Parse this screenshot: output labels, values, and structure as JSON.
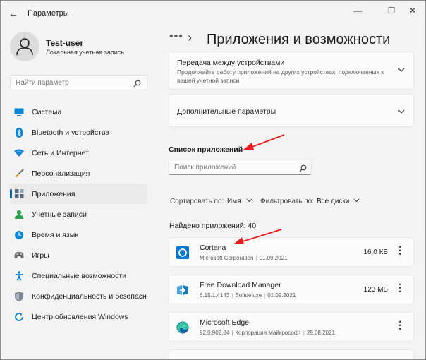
{
  "window": {
    "title": "Параметры",
    "back_glyph": "←",
    "controls": [
      "—",
      "☐",
      "✕"
    ]
  },
  "profile": {
    "name": "Test-user",
    "account_type": "Локальная учетная запись"
  },
  "sidebar_search": {
    "placeholder": "Найти параметр"
  },
  "nav": {
    "items": [
      {
        "label": "Система",
        "icon": "monitor-icon",
        "active": false
      },
      {
        "label": "Bluetooth и устройства",
        "icon": "bluetooth-icon",
        "active": false
      },
      {
        "label": "Сеть и Интернет",
        "icon": "wifi-icon",
        "active": false
      },
      {
        "label": "Персонализация",
        "icon": "brush-icon",
        "active": false
      },
      {
        "label": "Приложения",
        "icon": "apps-icon",
        "active": true
      },
      {
        "label": "Учетные записи",
        "icon": "person-icon",
        "active": false
      },
      {
        "label": "Время и язык",
        "icon": "globe-clock-icon",
        "active": false
      },
      {
        "label": "Игры",
        "icon": "gamepad-icon",
        "active": false
      },
      {
        "label": "Специальные возможности",
        "icon": "accessibility-icon",
        "active": false
      },
      {
        "label": "Конфиденциальность и безопасность",
        "icon": "shield-icon",
        "active": false
      },
      {
        "label": "Центр обновления Windows",
        "icon": "update-icon",
        "active": false
      }
    ]
  },
  "header": {
    "breadcrumb_dots": "•••",
    "separator": "›",
    "title": "Приложения и возможности"
  },
  "cards": {
    "share": {
      "title": "Передача между устройствами",
      "description": "Продолжайте работу приложений на других устройствах, подключенных к вашей учетной записи"
    },
    "advanced": {
      "title": "Дополнительные параметры"
    }
  },
  "app_list": {
    "heading": "Список приложений",
    "search_placeholder": "Поиск приложений",
    "sort_label": "Сортировать по:",
    "sort_value": "Имя",
    "filter_label": "Фильтровать по:",
    "filter_value": "Все диски",
    "found_text": "Найдено приложений: 40",
    "apps": [
      {
        "name": "Cortana",
        "version": "",
        "publisher": "Microsoft Corporation",
        "date": "01.09.2021",
        "size": "16,0 КБ",
        "icon": "cortana-icon"
      },
      {
        "name": "Free Download Manager",
        "version": "6.15.1.4143",
        "publisher": "Softdeluxe",
        "date": "01.09.2021",
        "size": "123 МБ",
        "icon": "fdm-icon"
      },
      {
        "name": "Microsoft Edge",
        "version": "92.0.902.84",
        "publisher": "Корпорация Майкрософт",
        "date": "29.08.2021",
        "size": "",
        "icon": "edge-icon"
      }
    ]
  },
  "colors": {
    "accent": "#0067c0",
    "annotation_arrow": "#e81c1c"
  }
}
